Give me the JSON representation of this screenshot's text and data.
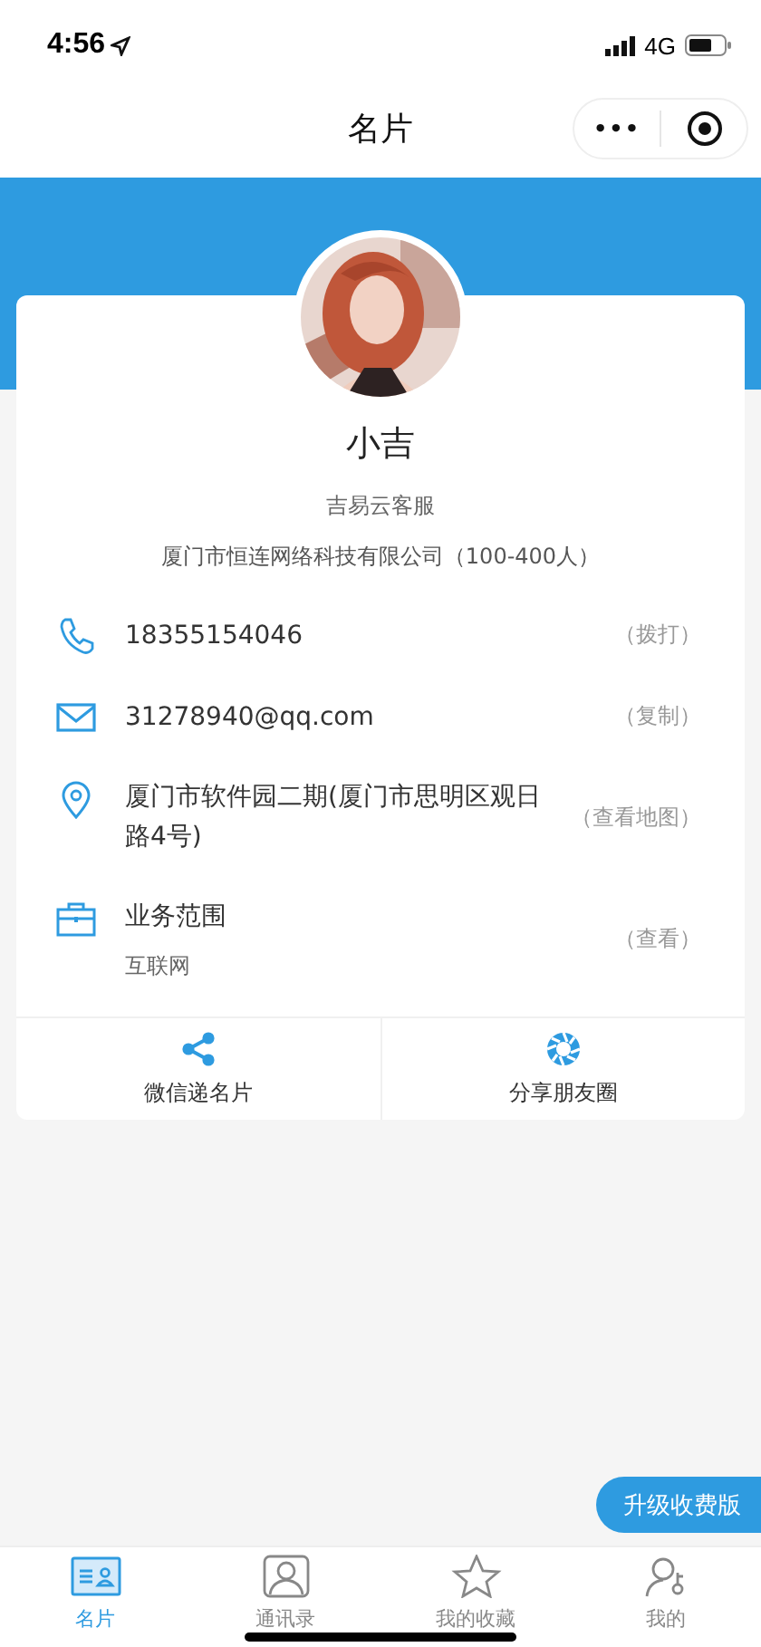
{
  "status_bar": {
    "time": "4:56",
    "network": "4G"
  },
  "nav": {
    "title": "名片",
    "more_icon": "•••"
  },
  "profile": {
    "name": "小吉",
    "position": "吉易云客服",
    "company": "厦门市恒连网络科技有限公司（100-400人）"
  },
  "contacts": [
    {
      "kind": "phone",
      "value": "18355154046",
      "action": "（拨打）"
    },
    {
      "kind": "email",
      "value": "31278940@qq.com",
      "action": "（复制）"
    },
    {
      "kind": "address",
      "value": "厦门市软件园二期(厦门市思明区观日路4号)",
      "action": "（查看地图）"
    },
    {
      "kind": "business",
      "value": "业务范围",
      "detail": "互联网",
      "action": "（查看）"
    }
  ],
  "share_actions": [
    {
      "kind": "wechat",
      "label": "微信递名片"
    },
    {
      "kind": "moments",
      "label": "分享朋友圈"
    }
  ],
  "upgrade_button": "升级收费版",
  "tabs": [
    {
      "kind": "card",
      "label": "名片",
      "selected": true
    },
    {
      "kind": "contacts",
      "label": "通讯录",
      "selected": false
    },
    {
      "kind": "favorites",
      "label": "我的收藏",
      "selected": false
    },
    {
      "kind": "mine",
      "label": "我的",
      "selected": false
    }
  ]
}
